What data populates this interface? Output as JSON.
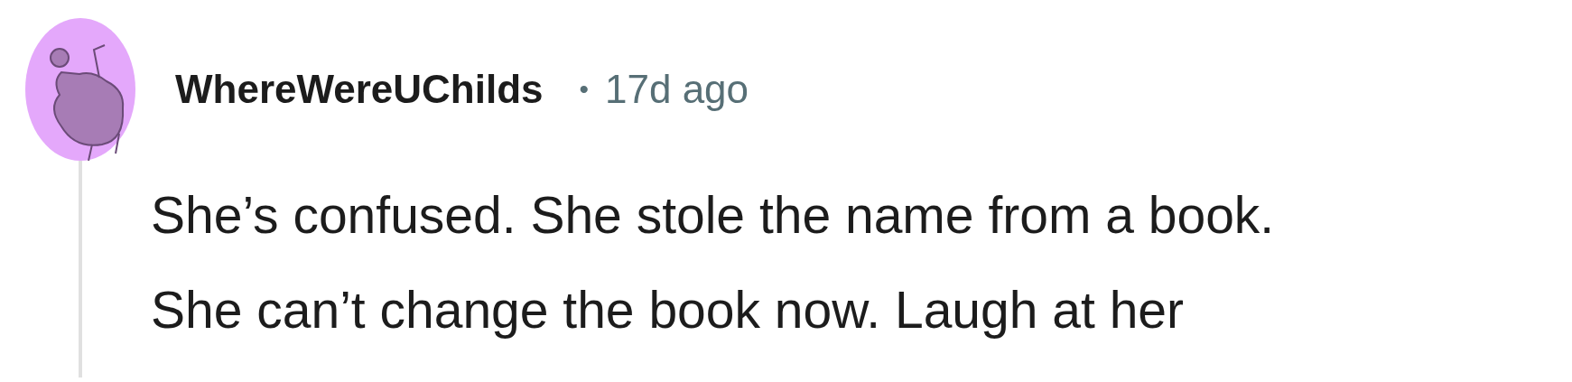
{
  "comment": {
    "author": "WhereWereUChilds",
    "separator": "•",
    "time": "17d ago",
    "lines": [
      "She’s confused. She stole the name from a book.",
      "She can’t change the book now. Laugh at her"
    ]
  }
}
